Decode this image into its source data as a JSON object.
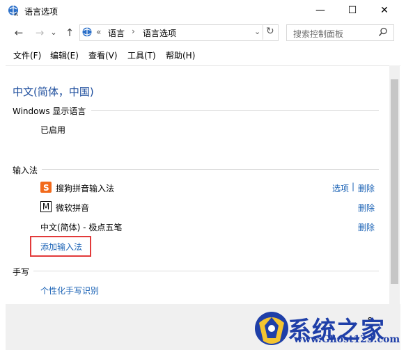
{
  "window": {
    "title": "语言选项",
    "minimize": "—",
    "maximize": "☐",
    "close": "✕"
  },
  "nav": {
    "back": "←",
    "forward": "→",
    "dropdown": "⌄",
    "up": "↑",
    "breadcrumb_prefix": "«",
    "breadcrumb": [
      "语言",
      "语言选项"
    ],
    "breadcrumb_sep": "›",
    "refresh": "↻",
    "search_placeholder": "搜索控制面板"
  },
  "menu": [
    "文件(F)",
    "编辑(E)",
    "查看(V)",
    "工具(T)",
    "帮助(H)"
  ],
  "language_title": "中文(简体，中国)",
  "display_language": {
    "header": "Windows 显示语言",
    "status": "已启用"
  },
  "input_methods": {
    "header": "输入法",
    "items": [
      {
        "name": "搜狗拼音输入法",
        "icon": "sogou-icon",
        "options": "选项",
        "sep": "|",
        "remove": "删除"
      },
      {
        "name": "微软拼音",
        "icon": "microsoft-pinyin-icon",
        "icon_glyph": "M",
        "remove": "删除"
      },
      {
        "name": "中文(简体) - 极点五笔",
        "remove": "删除"
      }
    ],
    "add": "添加输入法"
  },
  "handwriting": {
    "header": "手写",
    "link": "个性化手写识别"
  },
  "watermark": {
    "text": "系统之家",
    "url": "www.Ghost123.com",
    "partial": "s"
  },
  "colors": {
    "link": "#1a62b5",
    "title": "#1e4e9d",
    "highlight": "#e23a3a",
    "sogou": "#f26a1b"
  }
}
